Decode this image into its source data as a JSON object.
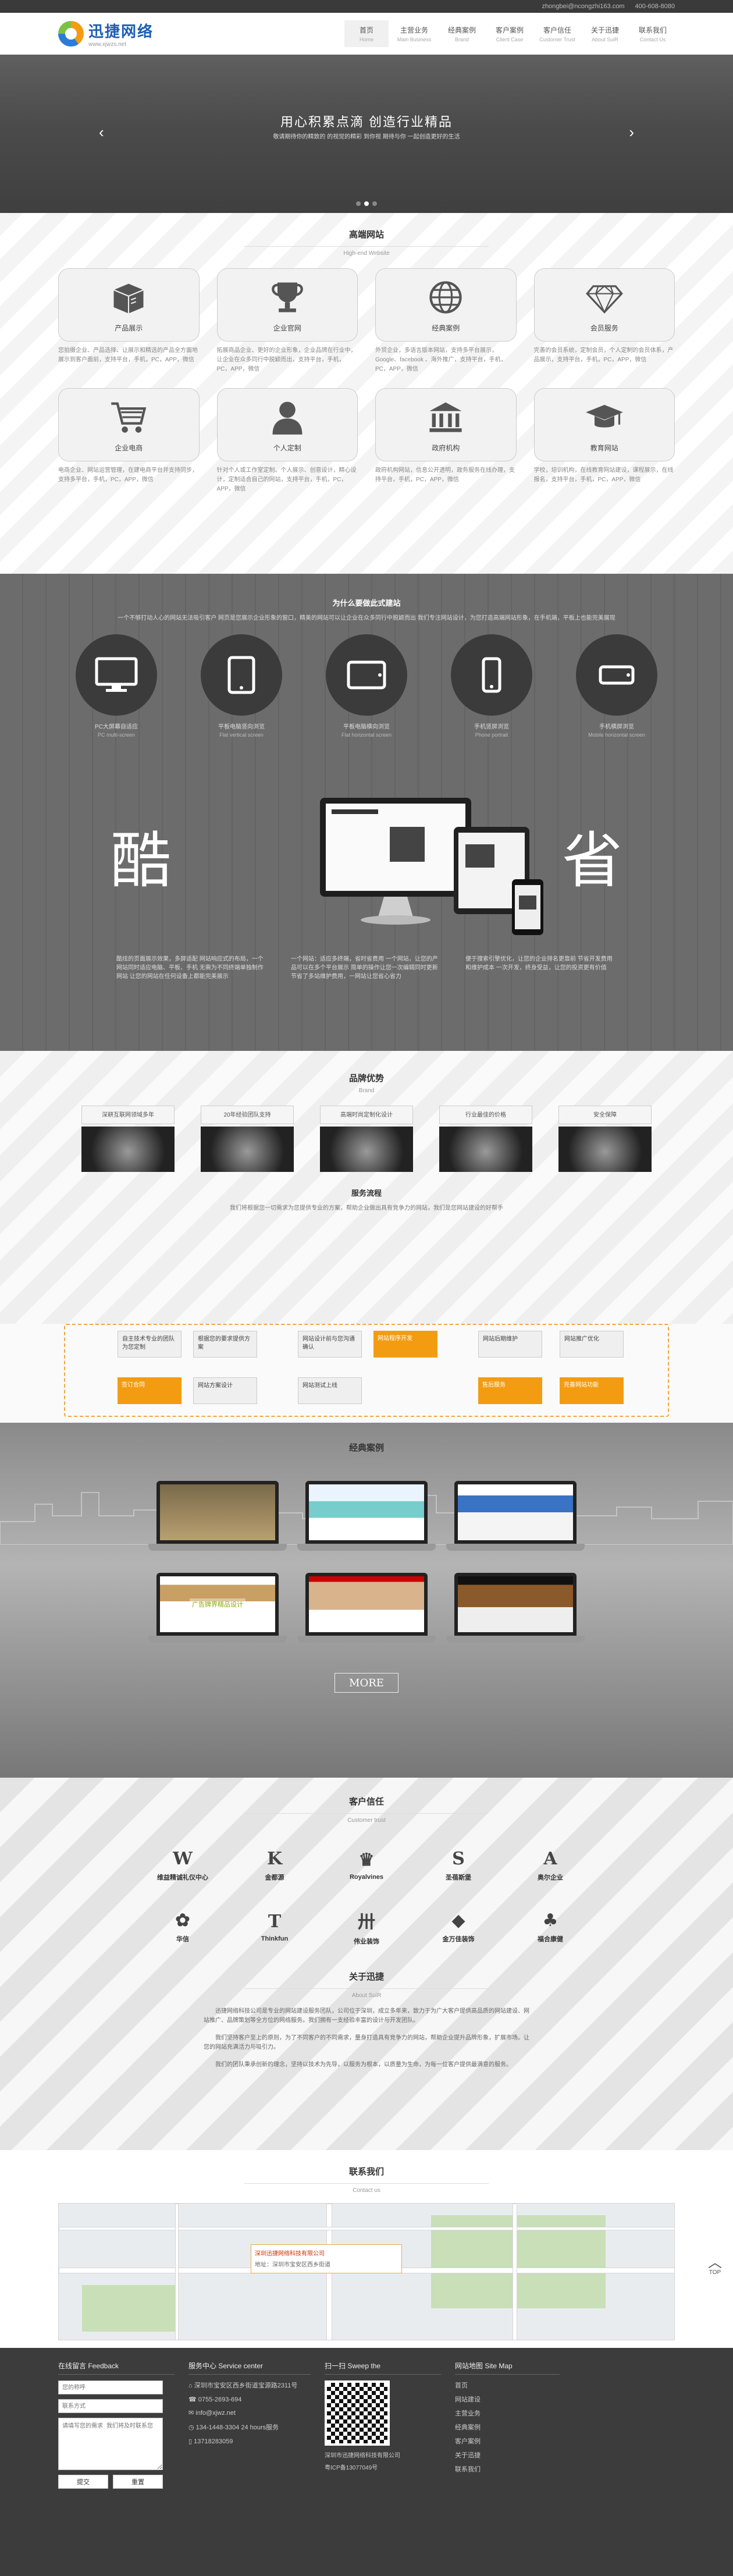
{
  "topbar": {
    "email": "zhongbei@ncongzhi163.com",
    "phone": "400-608-8080"
  },
  "brand": {
    "name": "迅捷网络",
    "url": "www.xjwzs.net"
  },
  "nav": [
    {
      "cn": "首页",
      "en": "Home"
    },
    {
      "cn": "主营业务",
      "en": "Main Business"
    },
    {
      "cn": "经典案例",
      "en": "Brand"
    },
    {
      "cn": "客户案例",
      "en": "Client Case"
    },
    {
      "cn": "客户信任",
      "en": "Customer Trust"
    },
    {
      "cn": "关于迅捷",
      "en": "About SuiR"
    },
    {
      "cn": "联系我们",
      "en": "Contact Us"
    }
  ],
  "banner": {
    "title": "用心积累点滴 创造行业精品",
    "sub": "敬请期待你的精致的 的视觉的精彩 到你视 期待与你 一起创造更好的生活"
  },
  "hiend": {
    "title": "高端网站",
    "sub": "High-end Website",
    "cards": [
      {
        "icon": "box-icon",
        "label": "产品展示",
        "desc": "您拍摄企业、产品选择、让展示和精选的产品全方面地展示到客户面前，支持平台，手机，PC，APP，微信"
      },
      {
        "icon": "trophy-icon",
        "label": "企业官网",
        "desc": "拓展商品企业、更好的企业形象，企业品牌在行业中，让企业在众多同行中脱颖而出，支持平台，手机，PC，APP，微信"
      },
      {
        "icon": "globe-icon",
        "label": "经典案例",
        "desc": "外贸企业，多语言版本网站，支持多平台展示，Google、facebook 、海外推广，支持平台，手机，PC，APP，微信"
      },
      {
        "icon": "diamond-icon",
        "label": "会员服务",
        "desc": "完善的会员系统，定制会员，个人定制的会员体系，产品展示，支持平台，手机，PC，APP，微信"
      },
      {
        "icon": "cart-icon",
        "label": "企业电商",
        "desc": "电商企业、网站运营管理，在建电商平台并支持同步，支持多平台，手机，PC，APP，微信"
      },
      {
        "icon": "user-icon",
        "label": "个人定制",
        "desc": "针对个人或工作室定制、个人展示、创意设计，精心设计，定制适合自己的网站，支持平台，手机，PC，APP，微信"
      },
      {
        "icon": "bank-icon",
        "label": "政府机构",
        "desc": "政府机构网站，信息公开透明，政务服务在线办理，支持平台，手机，PC，APP，微信"
      },
      {
        "icon": "grad-cap-icon",
        "label": "教育网站",
        "desc": "学校，培训机构，在线教育网站建设，课程展示，在线报名，支持平台，手机，PC，APP，微信"
      }
    ]
  },
  "why": {
    "title": "为什么要做此式建站",
    "intro": "一个不够打动人心的网站无法吸引客户 网页是您展示企业形象的窗口，精美的网站可以让企业在众多同行中脱颖而出 我们专注网站设计，为您打造高端网站形象，在手机端，平板上也能完美展现",
    "devices": [
      {
        "icon": "monitor-icon",
        "label": "PC大屏幕自适应",
        "en": "PC multi-screen"
      },
      {
        "icon": "tablet-v-icon",
        "label": "平板电脑竖向浏览",
        "en": "Flat vertical screen"
      },
      {
        "icon": "tablet-h-icon",
        "label": "平板电脑横向浏览",
        "en": "Flat horizontal screen"
      },
      {
        "icon": "phone-v-icon",
        "label": "手机竖屏浏览",
        "en": "Phone portrait"
      },
      {
        "icon": "phone-h-icon",
        "label": "手机横屏浏览",
        "en": "Mobile horizontal screen"
      }
    ],
    "left_word": "酷",
    "right_word": "省",
    "cols": [
      "酷炫的页面展示效果，多屏适配 网站响应式的布局，一个网站同时适应电脑、平板、手机 无需为不同终端单独制作网站 让您的网站在任何设备上都能完美展示",
      "一个网站：适应多终端，省时省费用 一个网站，让您的产品可以在多个平台展示 简单的操作让您一次编辑同时更新 节省了多站维护费用，一网站让您省心省力",
      "便于搜索引擎优化，让您的企业排名更靠前 节省开发费用和维护成本 一次开发，终身受益，让您的投资更有价值"
    ]
  },
  "brandsec": {
    "title": "品牌优势",
    "sub": "Brand",
    "items": [
      "深耕互联网领域多年",
      "20年经验团队支持",
      "高端时尚定制化设计",
      "行业最佳的价格",
      "安全保障"
    ],
    "process_title": "服务流程",
    "process_intro": "我们将根据您一切需求为您提供专业的方案，帮助企业做出具有竞争力的网站，我们是您网站建设的好帮手",
    "steps": [
      "自主技术专业的团队为您定制",
      "根据您的要求提供方案",
      "签订合同",
      "网站方案设计",
      "网站设计前与您沟通确认",
      "网站程序开发",
      "网站测试上线",
      "网站后期维护",
      "售后服务",
      "网站推广优化",
      "完善网站功能",
      "持续为您服务"
    ]
  },
  "cases": {
    "title": "经典案例",
    "sub": "Classic Case",
    "banner_text": "广告牌界精品设计",
    "more": "MORE"
  },
  "trust": {
    "title": "客户信任",
    "sub": "Customer trust",
    "logos": [
      {
        "mark": "W",
        "name": "维益精诚礼仪中心"
      },
      {
        "mark": "K",
        "name": "金都源"
      },
      {
        "mark": "♛",
        "name": "Royalvines"
      },
      {
        "mark": "S",
        "name": "圣蓓斯堡"
      },
      {
        "mark": "A",
        "name": "奥尔企业"
      },
      {
        "mark": "✿",
        "name": "华信"
      },
      {
        "mark": "T",
        "name": "Thinkfun"
      },
      {
        "mark": "卅",
        "name": "伟业装饰"
      },
      {
        "mark": "◆",
        "name": "金万佳装饰"
      },
      {
        "mark": "♣",
        "name": "福合康健"
      }
    ],
    "about_title": "关于迅捷",
    "about_sub": "About SuiR",
    "about_p1": "迅捷网络科技公司是专业的网站建设服务团队，公司位于深圳，成立多年来，致力于为广大客户提供高品质的网站建设、网站推广、品牌策划等全方位的网络服务。我们拥有一支经验丰富的设计与开发团队。",
    "about_p2": "我们坚持客户至上的原则，为了不同客户的不同需求，量身打造具有竞争力的网站，帮助企业提升品牌形象，扩展市场。让您的网站充满活力与吸引力。",
    "about_p3": "我们的团队秉承创新的理念，坚持以技术为先导，以服务为根本，以质量为生命，为每一位客户提供最满意的服务。"
  },
  "contact": {
    "title": "联系我们",
    "sub": "Contact us",
    "map_label": "深圳迅捷网络科技有限公司",
    "map_addr": "地址：深圳市宝安区西乡街道"
  },
  "footer": {
    "feedback_title": "在线留言 Feedback",
    "name_ph": "您的称呼",
    "contact_ph": "联系方式",
    "msg_ph": "请填写您的需求 我们将及时联系您",
    "submit": "提交",
    "reset": "重置",
    "service_title": "服务中心 Service center",
    "address": "深圳市宝安区西乡街道宝源路2311号",
    "phone": "0755-2693-694",
    "email": "info@xjwz.net",
    "hours": "134-1448-3304 24 hours服务",
    "mobile": "13718283059",
    "scan_title": "扫一扫 Sweep the",
    "scan_caption": "深圳市迅捷网络科技有限公司",
    "copyright": "粤ICP备13077049号",
    "sitemap_title": "网站地图 Site Map",
    "links": [
      "首页",
      "网站建设",
      "主营业务",
      "经典案例",
      "客户案例",
      "关于迅捷",
      "联系我们"
    ]
  },
  "totop": "TOP"
}
